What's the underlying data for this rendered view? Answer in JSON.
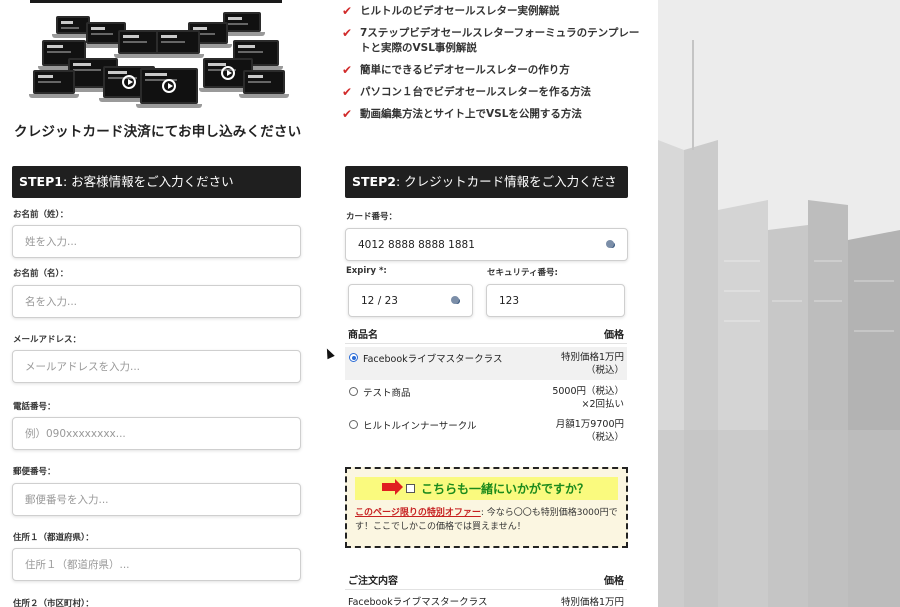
{
  "left": {
    "order_title": "クレジットカード決済にてお申し込みください",
    "step1": {
      "label": "STEP1",
      "title": ": お客様情報をご入力ください"
    },
    "fields": [
      {
        "label": "お名前（姓）：",
        "placeholder": "姓を入力..."
      },
      {
        "label": "お名前（名）：",
        "placeholder": "名を入力..."
      },
      {
        "label": "メールアドレス：",
        "placeholder": "メールアドレスを入力..."
      },
      {
        "label": "電話番号：",
        "placeholder": "例）090xxxxxxxx..."
      },
      {
        "label": "郵便番号：",
        "placeholder": "郵便番号を入力..."
      },
      {
        "label": "住所１（都道府県）：",
        "placeholder": "住所１（都道府県）..."
      },
      {
        "label": "住所２（市区町村）：",
        "placeholder": ""
      }
    ]
  },
  "features": [
    "ヒルトルのビデオセールスレター実例解説",
    "7ステップビデオセールスレターフォーミュラのテンプレートと実際のVSL事例解説",
    "簡単にできるビデオセールスレターの作り方",
    "パソコン１台でビデオセールスレターを作る方法",
    "動画編集方法とサイト上でVSLを公開する方法"
  ],
  "step2": {
    "label": "STEP2",
    "title": ": クレジットカード情報をご入力ください",
    "card_label": "カード番号：",
    "card_value": "4012 8888 8888 1881",
    "expiry_label": "Expiry *:",
    "expiry_value": "12 / 23",
    "cvc_label": "セキュリティ番号:",
    "cvc_value": "123",
    "card_icon": "credit-card-icon"
  },
  "products": {
    "header_name": "商品名",
    "header_price": "価格",
    "items": [
      {
        "name": "Facebookライブマスタークラス",
        "price_line1": "特別価格1万円",
        "price_line2": "（税込）",
        "selected": true
      },
      {
        "name": "テスト商品",
        "price_line1": "5000円（税込）",
        "price_line2": "×2回払い",
        "selected": false
      },
      {
        "name": "ヒルトルインナーサークル",
        "price_line1": "月額1万9700円",
        "price_line2": "（税込）",
        "selected": false
      }
    ]
  },
  "upsell": {
    "question": "こちらも一緒にいかがですか？",
    "offer_link": "このページ限りの特別オファー",
    "offer_text": ": 今なら〇〇も特別価格3000円です！ここでしかこの価格では買えません！",
    "arrow_color": "#e02020",
    "highlight_color": "#fafa7e"
  },
  "summary": {
    "header_name": "ご注文内容",
    "header_price": "価格",
    "row_name": "Facebookライブマスタークラス",
    "row_price": "特別価格1万円"
  },
  "colors": {
    "step_header_bg": "#1f1f1f",
    "check": "#d12a2a",
    "upsell_bg": "#fbf6e1"
  }
}
